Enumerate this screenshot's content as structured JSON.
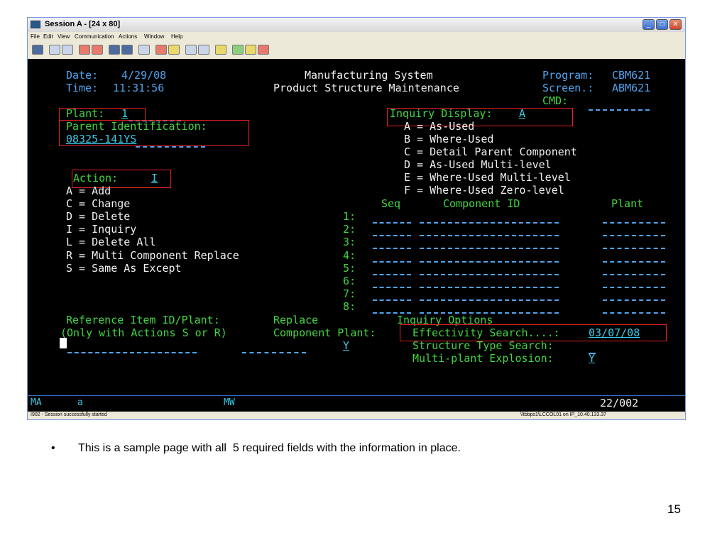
{
  "window": {
    "title": "Session A - [24 x 80]",
    "controls": {
      "minimize": "_",
      "maximize": "□",
      "close": "✕"
    }
  },
  "menu": [
    "File",
    "Edit",
    "View",
    "Communication",
    "Actions",
    "Window",
    "Help"
  ],
  "toolbar_icons": [
    "print-screen-icon",
    "copy-icon",
    "paste-icon",
    "send-icon",
    "receive-icon",
    "display-icon",
    "display-alt-icon",
    "macro-icon",
    "record-icon",
    "play-icon",
    "stop-icon",
    "transfer-icon",
    "transfer-alt-icon",
    "clipboard-icon",
    "color-icon",
    "edit-icon"
  ],
  "screen": {
    "date_label": "Date:",
    "date_value": "4/29/08",
    "time_label": "Time:",
    "time_value": "11:31:56",
    "title1": "Manufacturing System",
    "title2": "Product Structure Maintenance",
    "program_label": "Program:",
    "program_value": "CBM621",
    "screen_label": "Screen.:",
    "screen_value": "ABM621",
    "cmd_label": "CMD:",
    "plant_label": "Plant:",
    "plant_value": "1",
    "parent_label": "Parent Identification:",
    "parent_value": "08325-141YS",
    "inquiry_display_label": "Inquiry Display:",
    "inquiry_display_value": "A",
    "inquiry_options_list": [
      "A = As-Used",
      "B = Where-Used",
      "C = Detail Parent Component",
      "D = As-Used Multi-level",
      "E = Where-Used Multi-level",
      "F = Where-Used Zero-level"
    ],
    "action_label": "Action:",
    "action_value": "I",
    "actions_list": [
      "A = Add",
      "C = Change",
      "D = Delete",
      "I = Inquiry",
      "L = Delete All",
      "R = Multi Component Replace",
      "S = Same As Except"
    ],
    "table_headers": {
      "seq": "Seq",
      "component": "Component ID",
      "plant": "Plant"
    },
    "row_numbers": [
      "1:",
      "2:",
      "3:",
      "4:",
      "5:",
      "6:",
      "7:",
      "8:"
    ],
    "ref_label": "Reference Item ID/Plant:",
    "ref_note": "(Only with Actions S or R)",
    "replace_label": "Replace",
    "comp_plant_label": "Component Plant:",
    "comp_plant_value": "Y",
    "inquiry_options_title": "Inquiry Options",
    "eff_label": "Effectivity Search....:",
    "eff_value": "03/07/08",
    "struct_label": "Structure Type Search:",
    "multi_label": "Multi-plant Explosion:",
    "multi_value": "Y"
  },
  "oia": {
    "left": "MA",
    "mode": "a",
    "mw": "MW",
    "position": "22/002"
  },
  "status": {
    "message": "I902 - Session successfully started",
    "connection": "\\\\tbbps1\\LCCOL01 on IP_10.40.133.37"
  },
  "caption": "This is a sample page with all  5 required fields with the information in place.",
  "bullet": "•",
  "page_number": "15",
  "colors": {
    "field_green": "#40d640",
    "input_blue": "#4fa4ee",
    "highlight_box": "#e82020",
    "screen_bg": "#000000"
  }
}
